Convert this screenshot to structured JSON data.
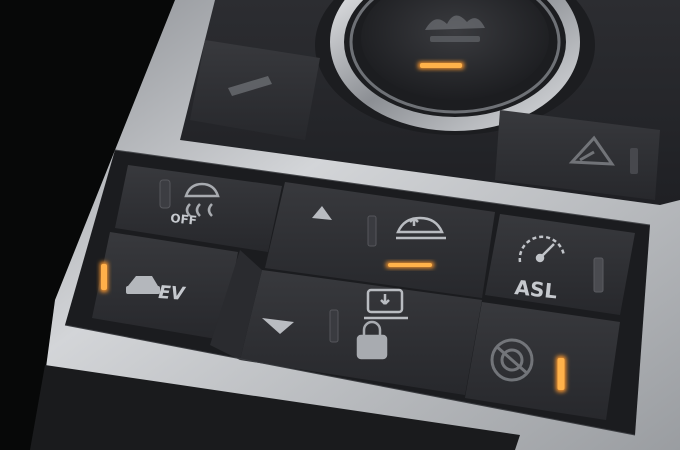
{
  "colors": {
    "background": "#0b0c0e",
    "panel": "#2a2b2f",
    "button": "#2f3034",
    "bezel": "#bfc2c6",
    "glyph": "#c6c9ce",
    "indicator_on": "#ff9a2e",
    "indicator_off": "#4a4b50"
  },
  "controls": {
    "terrain_dial": {
      "icon": "terrain-response-icon",
      "indicator": "on"
    },
    "top_left_button": {
      "icon": "ambient-icon"
    },
    "top_right_button": {
      "icon": "hill-descent-icon"
    },
    "traction_off_button": {
      "icon": "skid-car-icon",
      "label": "OFF"
    },
    "ev_button": {
      "icon": "ev-vehicle-icon",
      "label": "EV",
      "indicator": "on"
    },
    "height_raise_button": {
      "icon": "raise-suspension-icon",
      "indicator": "on"
    },
    "height_lower_button": {
      "icon": "lower-suspension-icon"
    },
    "asl_button": {
      "icon": "speed-limiter-icon",
      "label": "ASL",
      "indicator": "off"
    },
    "drive_mode_button": {
      "icon": "drive-mode-icon",
      "indicator": "on"
    }
  }
}
